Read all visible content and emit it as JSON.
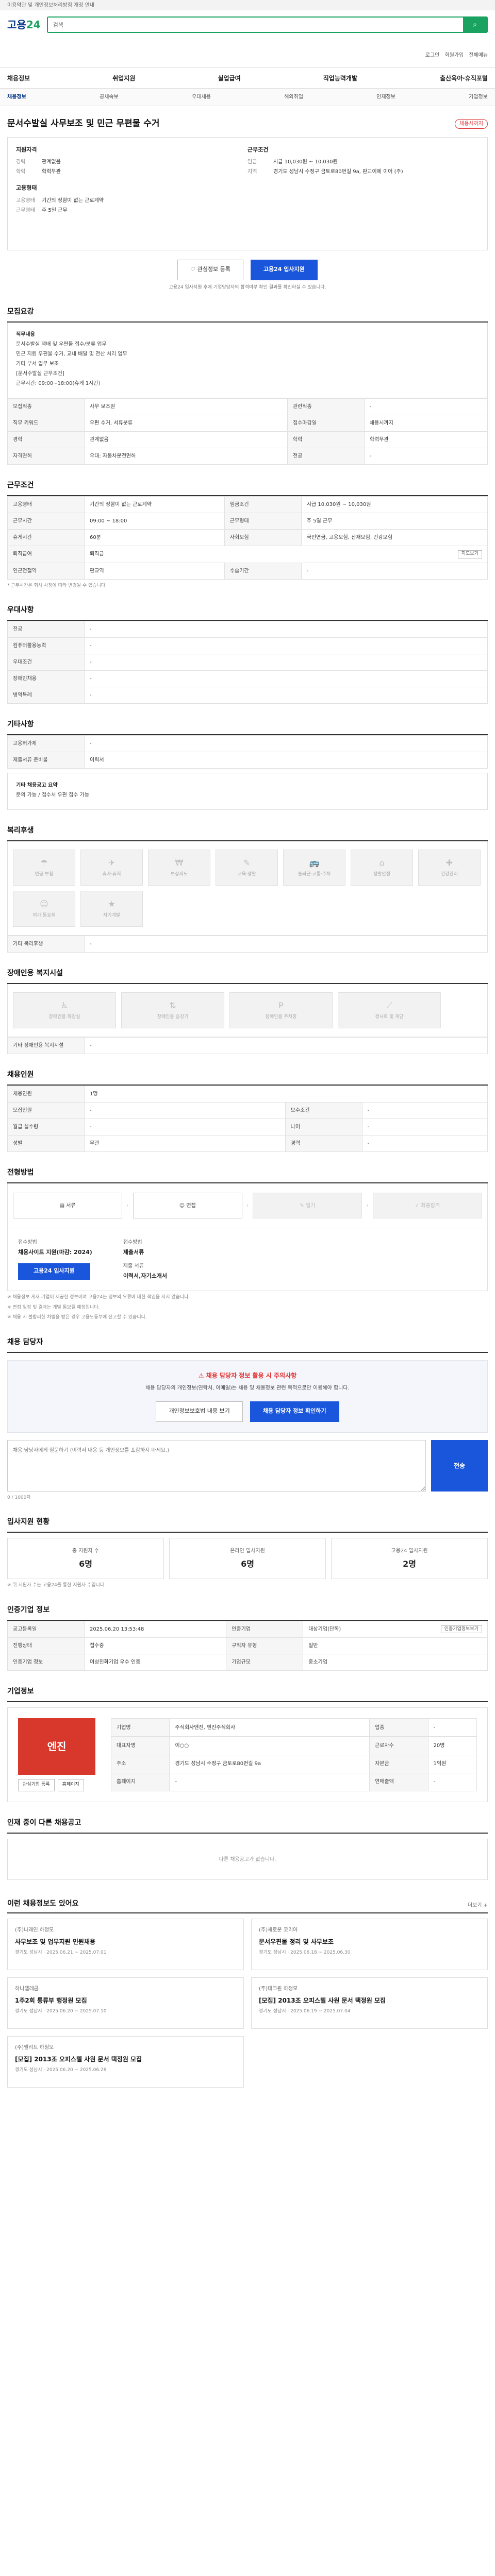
{
  "topbar": {
    "notice": "이용약관 및 개인정보처리방침 개정 안내"
  },
  "header": {
    "logo_main": "고용",
    "logo_num": "24",
    "search_placeholder": "검색",
    "util": [
      "로그인",
      "회원가입",
      "전체메뉴"
    ]
  },
  "gnb": [
    "채용정보",
    "취업지원",
    "실업급여",
    "직업능력개발",
    "출산육아·휴직포털"
  ],
  "subnav": [
    "채용정보",
    "공채속보",
    "우대채용",
    "해외취업",
    "인재정보",
    "기업정보"
  ],
  "job": {
    "title": "문서수발실 사무보조 및 민근 무편물 수거",
    "badge": "채용시까지",
    "left_title": "지원자격",
    "left_rows": [
      {
        "k": "경력",
        "v": "관계없음"
      },
      {
        "k": "학력",
        "v": "학력무관"
      }
    ],
    "left_title2": "고용형태",
    "left_rows2": [
      {
        "k": "고용형태",
        "v": "기간의 정함이 없는 근로계약"
      },
      {
        "k": "근무형태",
        "v": "주 5일 근무"
      }
    ],
    "right_title": "근무조건",
    "right_rows": [
      {
        "k": "임금",
        "v": "시급 10,030원 ~ 10,030원"
      },
      {
        "k": "지역",
        "v": "경기도 성남시 수정구 금토로80번길 9a, 판교이에 이어 (주)"
      }
    ],
    "btn_interest": "관심정보 등록",
    "btn_apply": "고용24 입사지원",
    "apply_note": "고용24 입사지원 후에 기업담당자의 합격여부 확인 결과를 확인하실 수 있습니다."
  },
  "sections": {
    "detail": "모집요강",
    "conditions": "근무조건",
    "preferred": "우대사항",
    "other": "기타사항",
    "welfare": "복리후생",
    "disability": "장애인용 복지시설",
    "recruit": "채용인원",
    "process": "전형방법",
    "contact": "채용 담당자",
    "stats": "입사지원 현황",
    "info": "인증기업 정보",
    "company": "기업정보",
    "similar": "인재 중이 다른 채용공고",
    "recommend": "이런 채용정보도 있어요"
  },
  "detail": {
    "label1": "직무내용",
    "lines": [
      "문서수발실 택배 및 우편물 접수/분류 업무",
      "민근 지원 우편물 수거, 교내 배달 및 전산 처리 업무",
      "기타 부서 업무 보조",
      "",
      "[문서수발실 근무조건]",
      "근무시간: 09:00~18:00(휴게 1시간)"
    ],
    "rows": [
      {
        "k": "모집직종",
        "v": "사무 보조원",
        "k2": "관련직종",
        "v2": "-"
      },
      {
        "k": "직무 키워드",
        "v": "우편 수거, 서류분류",
        "k2": "접수마감일",
        "v2": "채용시까지"
      },
      {
        "k": "경력",
        "v": "관계없음",
        "k2": "학력",
        "v2": "학력무관"
      },
      {
        "k": "자격면허",
        "v": "우대: 자동차운전면허",
        "k2": "전공",
        "v2": "-"
      }
    ]
  },
  "conditions": {
    "rows": [
      {
        "k": "고용형태",
        "v": "기간의 정함이 없는 근로계약",
        "k2": "임금조건",
        "v2": "시급 10,030원 ~ 10,030원"
      },
      {
        "k": "근무시간",
        "v": "09:00 ~ 18:00",
        "k2": "근무형태",
        "v2": "주 5일 근무"
      },
      {
        "k": "휴게시간",
        "v": "60분",
        "k2": "사회보험",
        "v2": "국민연금, 고용보험, 산재보험, 건강보험"
      },
      {
        "k": "퇴직급여",
        "v": "퇴직금",
        "k2": "근무예정지",
        "v2": "경기도 성남시 수정구 금토로80번길 9a"
      },
      {
        "k": "인근전철역",
        "v": "판교역",
        "k2": "수습기간",
        "v2": "-"
      }
    ],
    "map_btn": "지도보기",
    "note": "* 근무시간은 회사 사정에 따라 변경될 수 있습니다."
  },
  "preferred": {
    "rows": [
      {
        "k": "전공",
        "v": "-"
      },
      {
        "k": "컴퓨터활용능력",
        "v": "-"
      },
      {
        "k": "우대조건",
        "v": "-"
      },
      {
        "k": "장애인채용",
        "v": "-"
      },
      {
        "k": "병역특례",
        "v": "-"
      }
    ]
  },
  "other": {
    "rows": [
      {
        "k": "고용허가제",
        "v": "-"
      },
      {
        "k": "제출서류 준비물",
        "v": "이력서"
      }
    ],
    "extra_label": "기타 채용공고 요약",
    "extra_text": "문의 가능 / 접수처 우편 접수 가능"
  },
  "welfare": {
    "items": [
      "연금·보험",
      "휴가·휴직",
      "보상제도",
      "교육·생활",
      "출퇴근·교통·주차",
      "생활안정",
      "건강관리",
      "여가·동호회",
      "자기계발"
    ],
    "icons": [
      "☂",
      "✈",
      "₩",
      "✎",
      "🚌",
      "⌂",
      "✚",
      "☺",
      "★"
    ],
    "extra_label": "기타 복리후생",
    "extra_text": "-"
  },
  "disability": {
    "items": [
      "장애인용 화장실",
      "장애인용 승강기",
      "장애인용 주차장",
      "경사로 및 계단"
    ],
    "icons": [
      "♿",
      "⇅",
      "P",
      "⟋"
    ],
    "extra_label": "기타 장애인용 복지시설",
    "extra_text": "-"
  },
  "recruit": {
    "rows": [
      {
        "k": "채용인원",
        "v": "1명",
        "k2": "",
        "v2": ""
      },
      {
        "k": "모집인원",
        "v": "-",
        "k2": "보수조건",
        "v2": "-"
      },
      {
        "k": "월급 실수령",
        "v": "-",
        "k2": "나이",
        "v2": "-"
      },
      {
        "k": "성별",
        "v": "무관",
        "k2": "경력",
        "v2": "-"
      }
    ]
  },
  "process": {
    "steps": [
      "서류",
      "면접",
      "필기",
      "최종합격"
    ],
    "off": [
      false,
      false,
      true,
      true
    ],
    "how_label": "접수방법",
    "how_value": "채용사이트 지원(마감: 2024)",
    "doc_label": "접수방법",
    "doc_value": "제출서류",
    "form_label": "제출 서류",
    "form_value": "이력서,자기소개서",
    "apply_btn": "고용24 입사지원",
    "notes": [
      "※ 채용정보 게재 기업이 제공한 정보이며 고용24는 정보의 오류에 대한 책임을 지지 않습니다.",
      "※ 면접 일정 및 결과는 개별 통보될 예정입니다.",
      "※ 채용 시 불합리한 차별을 받은 경우 고용노동부에 신고할 수 있습니다."
    ]
  },
  "contact": {
    "warn_title": "채용 담당자 정보 활용 시 주의사항",
    "warn_text": "채용 담당자의 개인정보(연락처, 이메일)는 채용 및 채용정보 관련 목적으로만 이용해야 합니다.",
    "btn_check": "개인정보보호법 내용 보기",
    "btn_show": "채용 담당자 정보 확인하기",
    "textarea_placeholder": "채용 담당자에게 질문하기 (이력서 내용 등 개인정보를 포함하지 마세요.)",
    "send": "전송",
    "count": "0 / 1000자"
  },
  "stats": {
    "items": [
      {
        "l": "총 지원자 수",
        "v": "6명"
      },
      {
        "l": "온라인 입사지원",
        "v": "6명"
      },
      {
        "l": "고용24 입사지원",
        "v": "2명"
      }
    ],
    "note": "※ 위 지원자 수는 고용24를 통한 지원자 수입니다."
  },
  "info": {
    "rows": [
      {
        "k": "공고등록일",
        "v": "2025.06.20 13:53:48",
        "k2": "인증기업",
        "v2": "대상기업(단독)"
      },
      {
        "k": "진행상태",
        "v": "접수중",
        "k2": "구직자 유형",
        "v2": "일반"
      },
      {
        "k": "인증기업 정보",
        "v": "여성친화기업 우수 인증",
        "k2": "기업규모",
        "v2": "중소기업"
      }
    ],
    "btn": "인증기업정보보기"
  },
  "company": {
    "logo_text": "엔진",
    "btn1": "관심기업 등록",
    "btn2": "홈페이지",
    "rows": [
      {
        "k": "기업명",
        "v": "주식회사엔진, 엔진주식회사",
        "k2": "업종",
        "v2": "-"
      },
      {
        "k": "대표자명",
        "v": "이○○",
        "k2": "근로자수",
        "v2": "20명"
      },
      {
        "k": "주소",
        "v": "경기도 성남시 수정구 금토로80번길 9a",
        "k2": "자본금",
        "v2": "1억원"
      },
      {
        "k": "홈페이지",
        "v": "-",
        "k2": "연매출액",
        "v2": "-"
      }
    ],
    "company_btn": "홈페이지"
  },
  "similar": {
    "empty": "다른 채용공고가 없습니다."
  },
  "recommend": {
    "more": "더보기 +",
    "cards": [
      {
        "corp": "(주)나래인 하청모",
        "title": "사무보조 및 업무지원 인원채용",
        "meta": "경기도 성남시 · 2025.06.21 ~ 2025.07.01"
      },
      {
        "corp": "(주)새로운 코리아",
        "title": "문서우편물 정리 및 사무보조",
        "meta": "경기도 성남시 · 2025.06.18 ~ 2025.06.30"
      },
      {
        "corp": "하나텔레콤",
        "title": "1주2회 통류부 행정원 모집",
        "meta": "경기도 성남시 · 2025.06.20 ~ 2025.07.10"
      },
      {
        "corp": "(주)테크윈 하청모",
        "title": "[모집] 2013조 오피스텔 사원 문서 택정원 모집",
        "meta": "경기도 성남시 · 2025.06.19 ~ 2025.07.04"
      },
      {
        "corp": "(주)엘리트 하청모",
        "title": "[모집] 2013조 오피스텔 사원 문서 택정원 모집",
        "meta": "경기도 성남시 · 2025.06.20 ~ 2025.06.28"
      }
    ]
  }
}
